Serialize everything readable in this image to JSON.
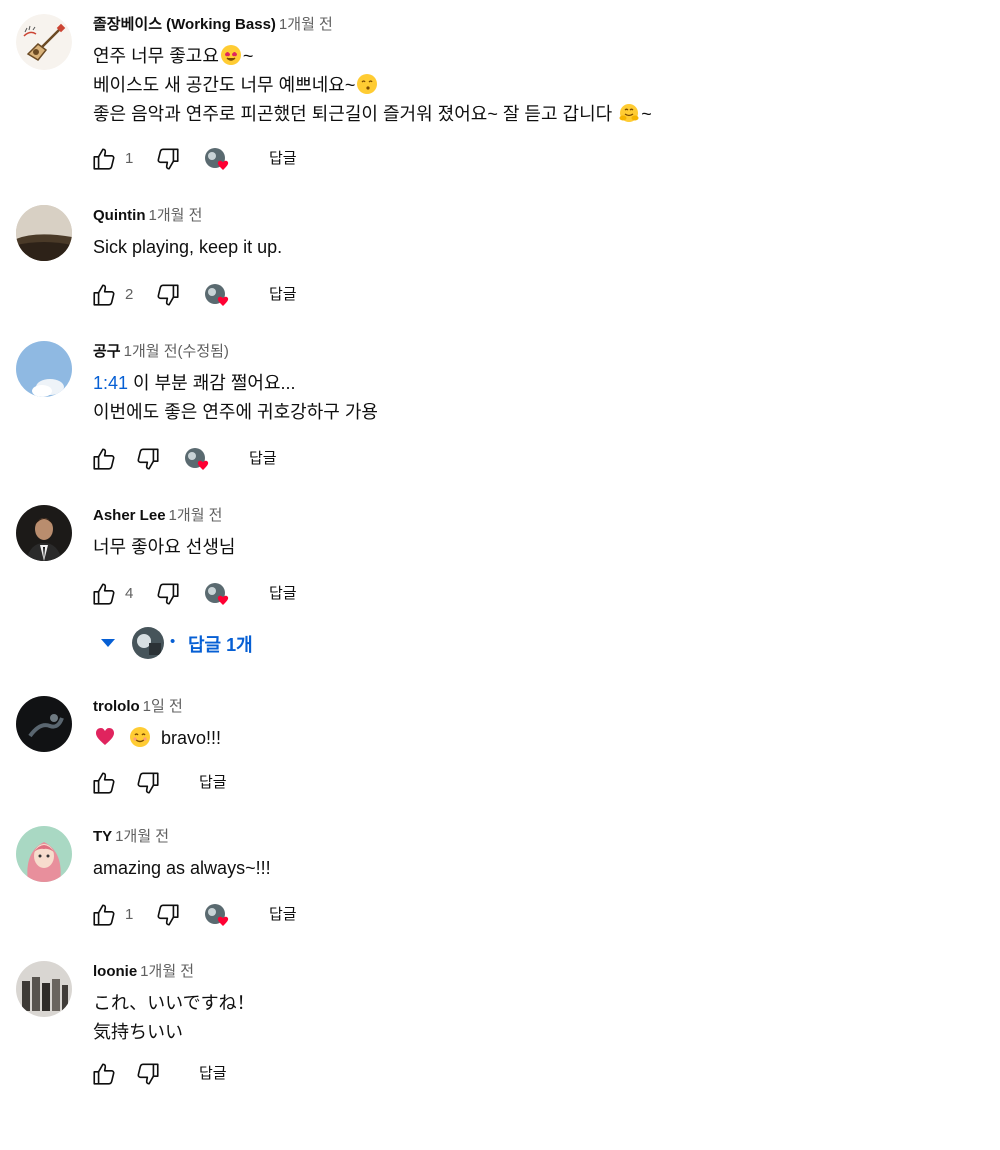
{
  "colors": {
    "accent": "#065fd4",
    "heart": "#ff0033",
    "meta": "#606060",
    "text": "#0f0f0f"
  },
  "comments": [
    {
      "author": "졸장베이스 (Working Bass)",
      "time": "1개월 전",
      "lines": [
        "연주 너무 좋고요",
        "베이스도 새 공간도 너무 예쁘네요~",
        "좋은 음악과 연주로 피곤했던 퇴근길이 즐거워 졌어요~ 잘 듣고 갑니다"
      ],
      "line_suffixes": [
        "~",
        "",
        "~"
      ],
      "likes": "1",
      "reply_label": "답글",
      "avatar_icon": "guitar-avatar-icon",
      "creator_heart": true
    },
    {
      "author": "Quintin",
      "time": "1개월 전",
      "lines": [
        "Sick playing, keep it up."
      ],
      "likes": "2",
      "reply_label": "답글",
      "avatar_icon": "landscape-avatar-icon",
      "creator_heart": true
    },
    {
      "author": "공구",
      "time": "1개월 전(수정됨)",
      "timestamp_link": "1:41",
      "lines": [
        " 이 부분 쾌감 쩔어요...",
        "이번에도 좋은 연주에 귀호강하구 가용"
      ],
      "likes": "",
      "reply_label": "답글",
      "avatar_icon": "sky-avatar-icon",
      "creator_heart": true
    },
    {
      "author": "Asher Lee",
      "time": "1개월 전",
      "lines": [
        "너무 좋아요 선생님"
      ],
      "likes": "4",
      "reply_label": "답글",
      "avatar_icon": "person-avatar-icon",
      "creator_heart": true,
      "replies_label": "답글 1개",
      "replies_separator": "•"
    },
    {
      "author": "trololo",
      "time": "1일 전",
      "lines": [
        "bravo!!!"
      ],
      "likes": "",
      "reply_label": "답글",
      "avatar_icon": "dark-avatar-icon",
      "creator_heart": false
    },
    {
      "author": "TY",
      "time": "1개월 전",
      "lines": [
        "amazing as always~!!!"
      ],
      "likes": "1",
      "reply_label": "답글",
      "avatar_icon": "anime-avatar-icon",
      "creator_heart": true
    },
    {
      "author": "loonie",
      "time": "1개월 전",
      "lines": [
        "これ、いいですね！",
        "気持ちいい"
      ],
      "likes": "",
      "reply_label": "답글",
      "avatar_icon": "crowd-avatar-icon",
      "creator_heart": false
    }
  ]
}
